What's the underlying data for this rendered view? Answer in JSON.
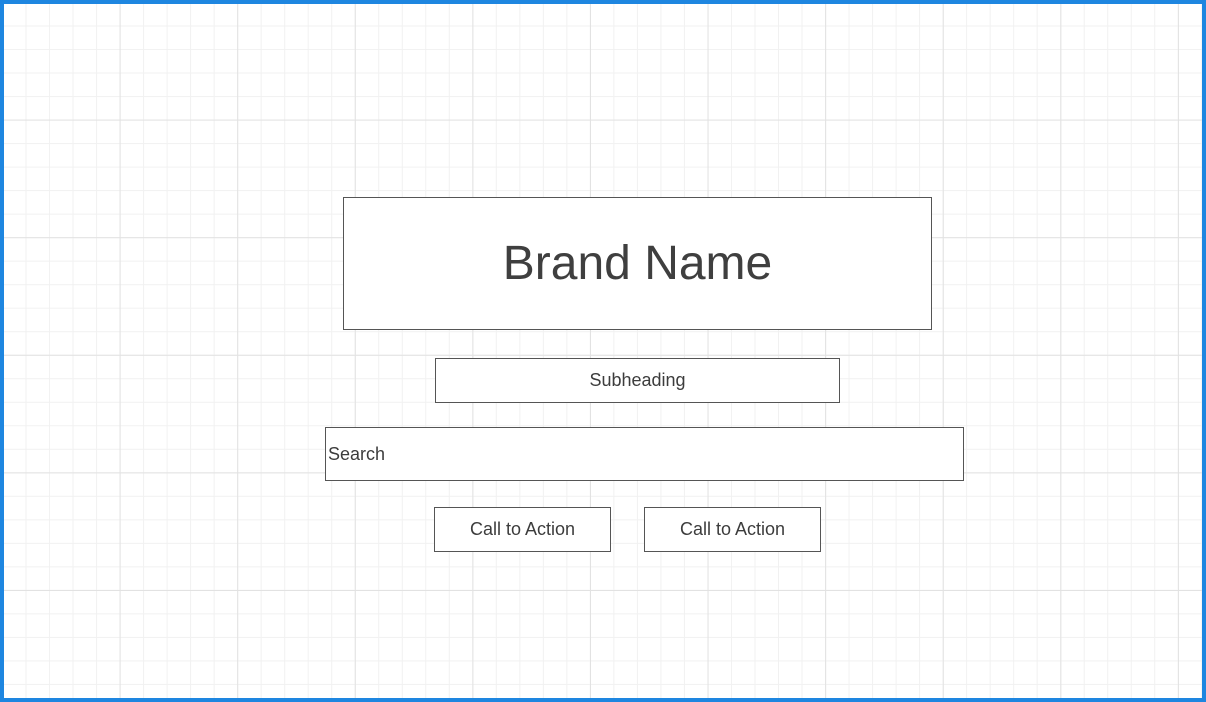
{
  "hero": {
    "brand_name": "Brand Name",
    "subheading": "Subheading",
    "search_placeholder": "Search",
    "cta_primary": "Call to Action",
    "cta_secondary": "Call to Action"
  },
  "colors": {
    "frame_border": "#1e86e0",
    "box_border": "#555555",
    "text": "#3c3c3c",
    "grid_line": "#e2e2e2"
  }
}
